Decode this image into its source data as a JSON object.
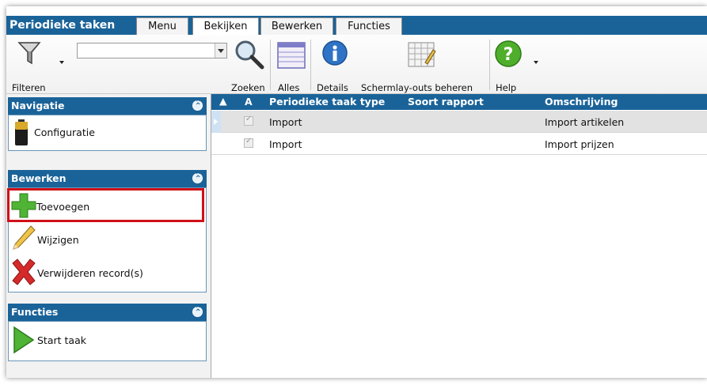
{
  "app": {
    "title": "Periodieke taken"
  },
  "tabs": [
    {
      "label": "Menu"
    },
    {
      "label": "Bekijken",
      "active": true
    },
    {
      "label": "Bewerken"
    },
    {
      "label": "Functies"
    }
  ],
  "ribbon": {
    "filter_label": "Filteren",
    "search_value": "",
    "search_label": "Zoeken",
    "all_label": "Alles",
    "details_label": "Details",
    "layouts_label": "Schermlay-outs beheren",
    "help_label": "Help"
  },
  "sidebar": {
    "groups": [
      {
        "title": "Navigatie",
        "items": [
          {
            "label": "Configuratie",
            "icon": "battery-icon"
          }
        ]
      },
      {
        "title": "Bewerken",
        "items": [
          {
            "label": "Toevoegen",
            "icon": "plus-icon"
          },
          {
            "label": "Wijzigen",
            "icon": "pencil-icon"
          },
          {
            "label": "Verwijderen record(s)",
            "icon": "delete-x-icon"
          }
        ]
      },
      {
        "title": "Functies",
        "items": [
          {
            "label": "Start taak",
            "icon": "play-icon"
          }
        ]
      }
    ]
  },
  "grid": {
    "columns": [
      "A",
      "Periodieke taak type",
      "Soort rapport",
      "Omschrijving"
    ],
    "rows": [
      {
        "active": true,
        "type": "Import",
        "report": "",
        "description": "Import artikelen",
        "selected": true
      },
      {
        "active": true,
        "type": "Import",
        "report": "",
        "description": "Import prijzen",
        "selected": false
      }
    ]
  },
  "colors": {
    "header_blue": "#1a6399",
    "highlight_red": "#d01018"
  }
}
